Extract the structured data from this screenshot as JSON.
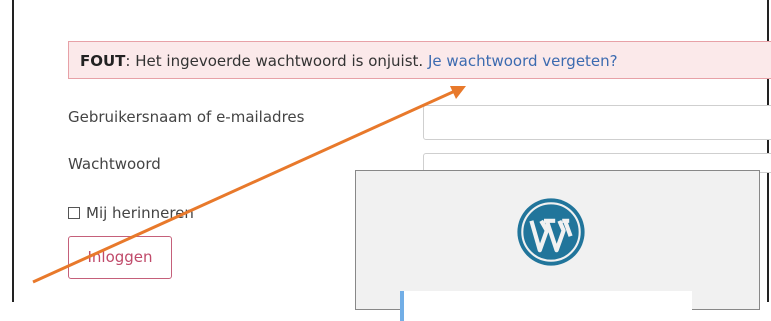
{
  "alert": {
    "prefix": "FOUT",
    "message": ": Het ingevoerde wachtwoord is onjuist. ",
    "link": "Je wachtwoord vergeten?"
  },
  "form": {
    "username_label": "Gebruikersnaam of e-mailadres",
    "password_label": "Wachtwoord",
    "remember_label": "Mij herinneren",
    "login_button": "Inloggen"
  },
  "colors": {
    "alert_bg": "#fbe9ea",
    "alert_border": "#e7a1a7",
    "link": "#3c6bb0",
    "button_text": "#c04a6a",
    "arrow": "#e8792b",
    "wp_blue": "#21759b"
  },
  "overlay": {
    "logo_icon": "wordpress-logo-icon"
  }
}
